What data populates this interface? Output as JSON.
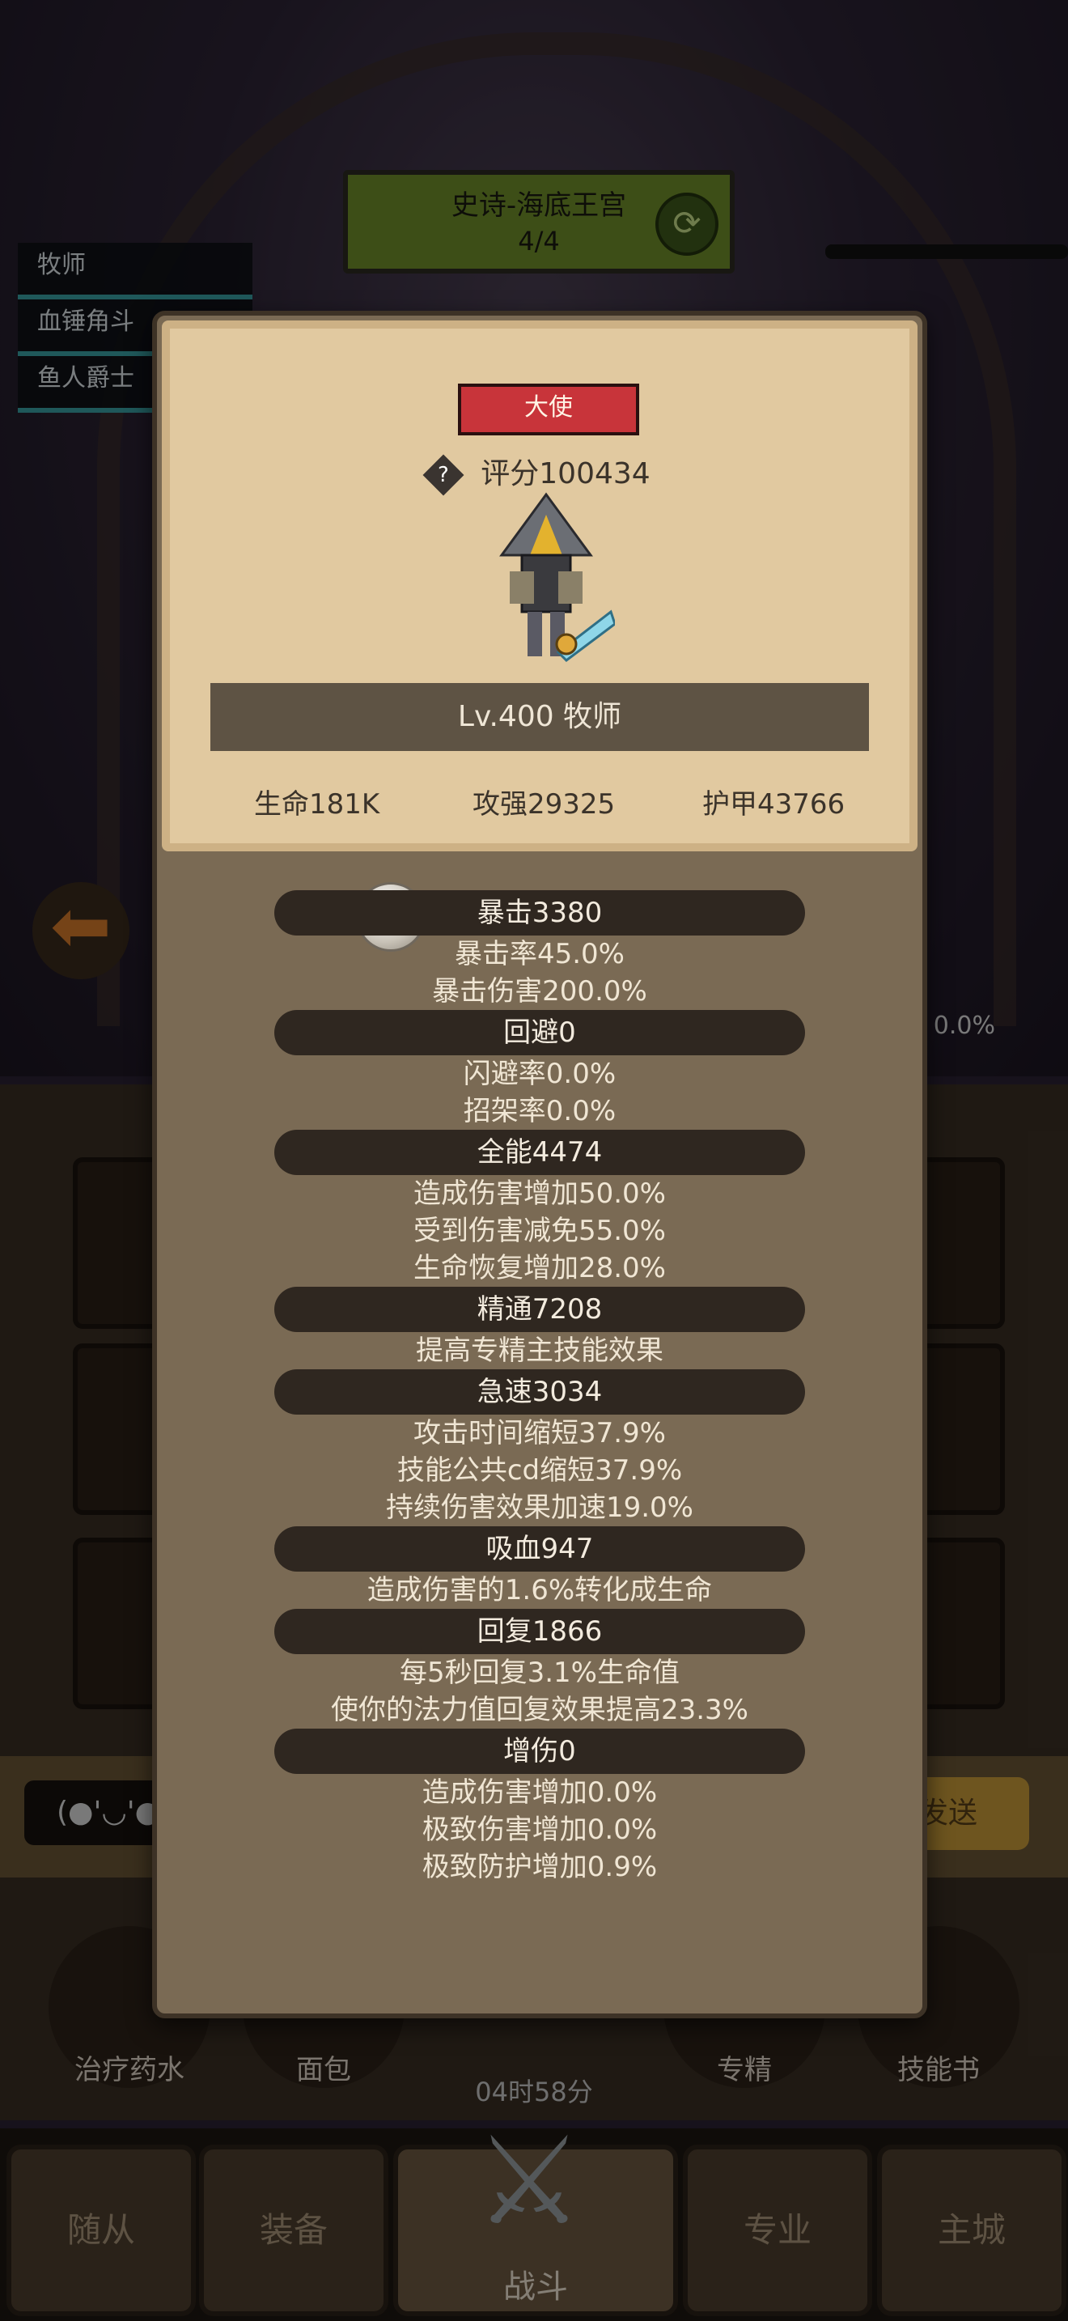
{
  "stage": {
    "name": "史诗-海底王宫",
    "progress": "4/4"
  },
  "party": [
    "牧师",
    "血锤角斗",
    "鱼人爵士"
  ],
  "background_right_percent": "0.0%",
  "chat": {
    "emote": "(●'◡'●",
    "send_label": "发送"
  },
  "quick_items": [
    {
      "label": "治疗药水"
    },
    {
      "label": "面包"
    },
    {
      "label": "专精"
    },
    {
      "label": "技能书"
    }
  ],
  "timer": "04时58分",
  "nav": {
    "followers": "随从",
    "equipment": "装备",
    "battle": "战斗",
    "profession": "专业",
    "city": "主城"
  },
  "panel": {
    "title": "大使",
    "score": "评分100434",
    "level_class": "Lv.400 牧师",
    "base": {
      "hp": "生命181K",
      "atk": "攻强29325",
      "armor": "护甲43766"
    },
    "stats": [
      {
        "header": "暴击3380",
        "lines": [
          "暴击率45.0%",
          "暴击伤害200.0%"
        ]
      },
      {
        "header": "回避0",
        "lines": [
          "闪避率0.0%",
          "招架率0.0%"
        ]
      },
      {
        "header": "全能4474",
        "lines": [
          "造成伤害增加50.0%",
          "受到伤害减免55.0%",
          "生命恢复增加28.0%"
        ]
      },
      {
        "header": "精通7208",
        "lines": [
          "提高专精主技能效果"
        ]
      },
      {
        "header": "急速3034",
        "lines": [
          "攻击时间缩短37.9%",
          "技能公共cd缩短37.9%",
          "持续伤害效果加速19.0%"
        ]
      },
      {
        "header": "吸血947",
        "lines": [
          "造成伤害的1.6%转化成生命"
        ]
      },
      {
        "header": "回复1866",
        "lines": [
          "每5秒回复3.1%生命值",
          "使你的法力值回复效果提高23.3%"
        ]
      },
      {
        "header": "增伤0",
        "lines": [
          "造成伤害增加0.0%",
          "极致伤害增加0.0%",
          "极致防护增加0.9%"
        ]
      }
    ]
  }
}
